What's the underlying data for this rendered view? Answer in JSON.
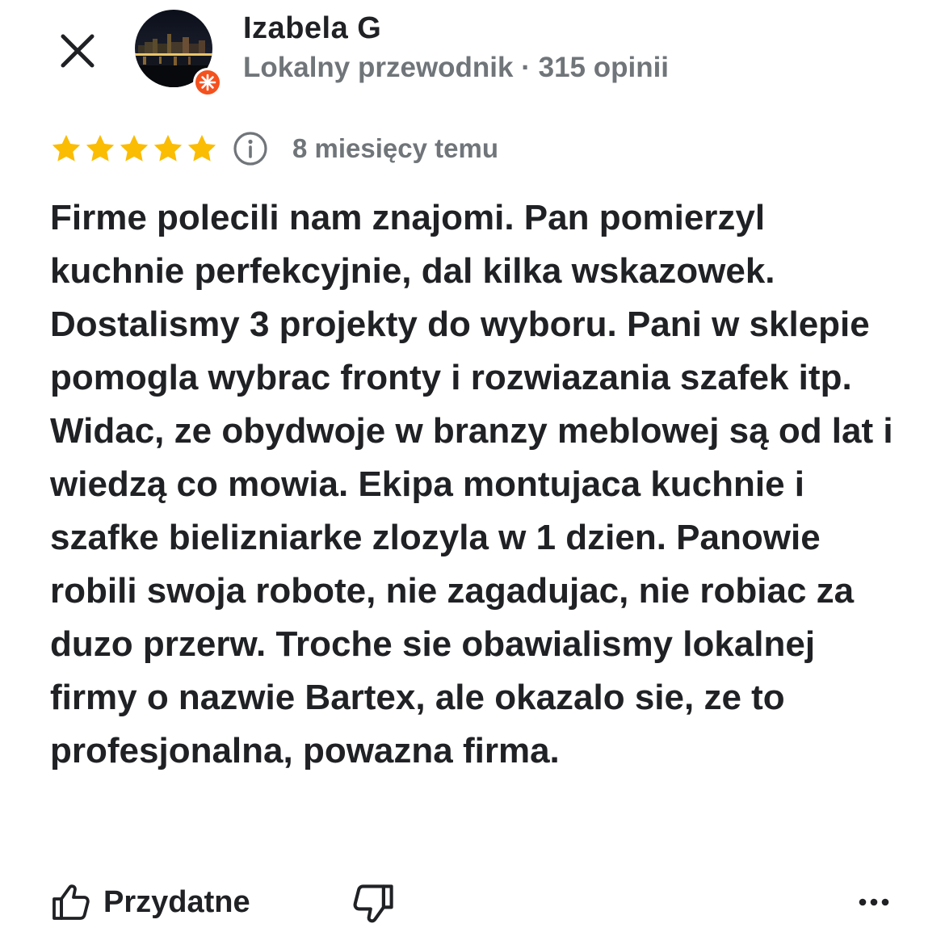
{
  "header": {
    "close_icon": "close-icon",
    "avatar_icon": "night-city-photo",
    "badge_icon": "local-guide-badge-icon",
    "author_name": "Izabela G",
    "author_meta": "Lokalny przewodnik · 315 opinii"
  },
  "rating": {
    "stars": 5,
    "max_stars": 5,
    "star_color": "#fbbc04",
    "info_icon": "info-icon",
    "date": "8 miesięcy temu"
  },
  "review": {
    "text": "Firme polecili nam znajomi. Pan pomierzyl kuchnie perfekcyjnie, dal kilka wskazowek. Dostalismy 3 projekty do wyboru. Pani w sklepie pomogla wybrac fronty i rozwiazania szafek itp. Widac, ze obydwoje w branzy meblowej są od lat i wiedzą co mowia. Ekipa montujaca kuchnie i szafke bielizniarke zlozyla w 1 dzien. Panowie robili swoja robote, nie zagadujac, nie robiac za duzo przerw. Troche sie obawialismy lokalnej firmy o nazwie Bartex, ale okazalo sie, ze to profesjonalna, powazna firma."
  },
  "actions": {
    "helpful_label": "Przydatne",
    "helpful_icon": "thumbs-up-icon",
    "dislike_icon": "thumbs-down-icon",
    "more_icon": "more-horizontal-icon"
  },
  "colors": {
    "text_primary": "#202124",
    "text_secondary": "#70757a",
    "star": "#fbbc04",
    "badge": "#f4511e"
  }
}
